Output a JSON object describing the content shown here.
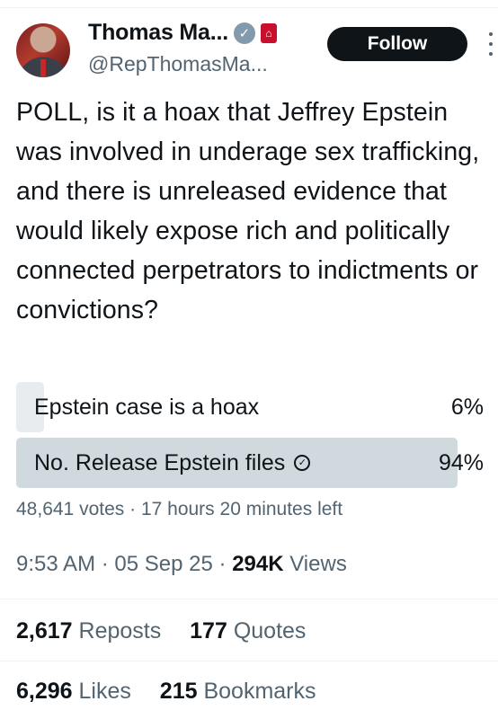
{
  "author": {
    "name": "Thomas Ma...",
    "handle": "@RepThomasMa...",
    "follow_label": "Follow"
  },
  "tweet": {
    "text": "POLL, is it a hoax that Jeffrey Epstein was involved in underage sex trafficking, and there is unreleased evidence that would likely expose rich and politically connected perpetrators to indictments or convictions?"
  },
  "poll": {
    "options": [
      {
        "label": "Epstein case is a hoax",
        "percent_text": "6%",
        "percent": 6,
        "winner": false
      },
      {
        "label": "No. Release Epstein files",
        "percent_text": "94%",
        "percent": 94,
        "winner": true
      }
    ],
    "votes": "48,641 votes",
    "separator": "·",
    "time_left": "17 hours 20 minutes left"
  },
  "meta": {
    "time": "9:53 AM",
    "date": "05 Sep 25",
    "separator": "·",
    "views_count": "294K",
    "views_label": "Views"
  },
  "stats": {
    "reposts_count": "2,617",
    "reposts_label": "Reposts",
    "quotes_count": "177",
    "quotes_label": "Quotes",
    "likes_count": "6,296",
    "likes_label": "Likes",
    "bookmarks_count": "215",
    "bookmarks_label": "Bookmarks"
  },
  "icons": {
    "verified": "verified-badge-icon",
    "government": "government-badge-icon",
    "more": "more-icon",
    "check": "check-circle-icon"
  }
}
